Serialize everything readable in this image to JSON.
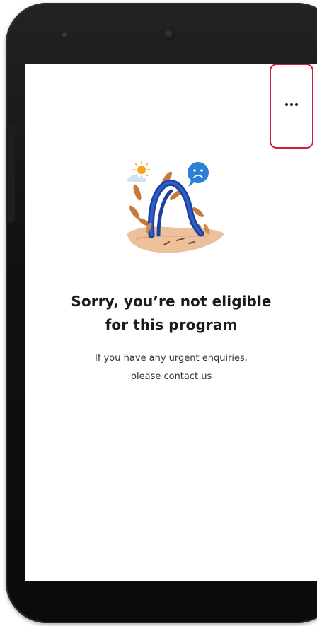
{
  "menu": {
    "icon": "more-horizontal-icon",
    "highlight_color": "#d21c3b"
  },
  "illustration": {
    "icon": "broken-arch-sad-illustration",
    "emoji": "sad-face-bubble-icon",
    "sun": "sun-icon"
  },
  "message": {
    "title_line1": "Sorry, you’re not eligible",
    "title_line2": "for this program",
    "body_line1": "If you have any urgent enquiries,",
    "body_line2": "please contact us"
  },
  "colors": {
    "bezel": "#111111",
    "screen": "#ffffff",
    "text": "#1a1a1a",
    "accent_blue": "#2e7fd6",
    "sand": "#e9b98f"
  }
}
